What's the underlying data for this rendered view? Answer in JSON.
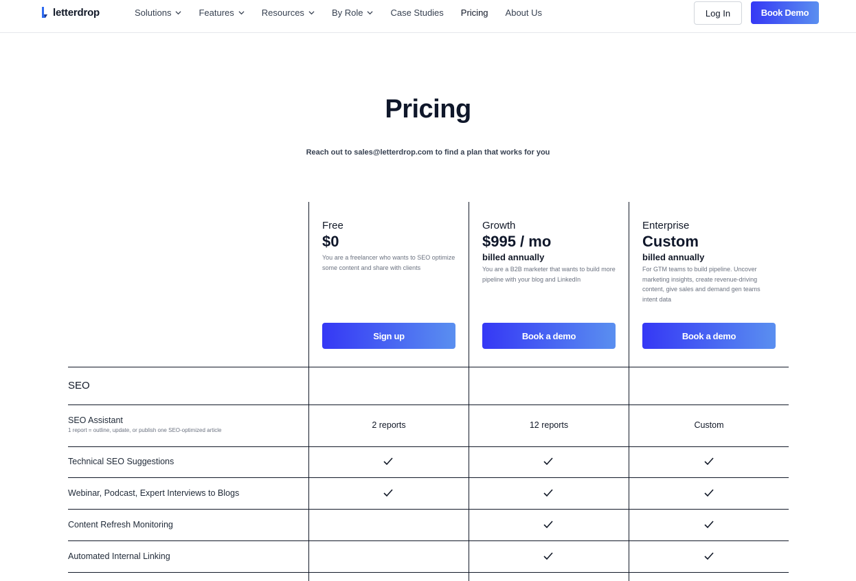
{
  "nav": {
    "logo_text": "letterdrop",
    "items": [
      {
        "label": "Solutions",
        "has_dropdown": true
      },
      {
        "label": "Features",
        "has_dropdown": true
      },
      {
        "label": "Resources",
        "has_dropdown": true
      },
      {
        "label": "By Role",
        "has_dropdown": true
      },
      {
        "label": "Case Studies",
        "has_dropdown": false
      },
      {
        "label": "Pricing",
        "has_dropdown": false
      },
      {
        "label": "About Us",
        "has_dropdown": false
      }
    ],
    "login_label": "Log In",
    "demo_label": "Book Demo"
  },
  "hero": {
    "title": "Pricing",
    "subtitle": "Reach out to sales@letterdrop.com to find a plan that works for you"
  },
  "plans": [
    {
      "name": "Free",
      "price": "$0",
      "billing": "",
      "description": "You are a freelancer who wants to SEO optimize some content and share with clients",
      "button": "Sign up"
    },
    {
      "name": "Growth",
      "price": "$995 / mo",
      "billing": "billed annually",
      "description": "You are a B2B marketer that wants to build more pipeline with your blog and LinkedIn",
      "button": "Book a demo"
    },
    {
      "name": "Enterprise",
      "price": "Custom",
      "billing": "billed annually",
      "description": "For GTM teams to build pipeline. Uncover marketing insights, create revenue-driving content, give sales and demand gen teams intent data",
      "button": "Book a demo"
    }
  ],
  "section": {
    "label": "SEO"
  },
  "features": [
    {
      "name": "SEO Assistant",
      "note": "1 report = outline, update, or publish one SEO-optimized article",
      "values": [
        "2 reports",
        "12 reports",
        "Custom"
      ]
    },
    {
      "name": "Technical SEO Suggestions",
      "note": "",
      "values": [
        "check",
        "check",
        "check"
      ]
    },
    {
      "name": "Webinar, Podcast, Expert Interviews to Blogs",
      "note": "",
      "values": [
        "check",
        "check",
        "check"
      ]
    },
    {
      "name": "Content Refresh Monitoring",
      "note": "",
      "values": [
        "",
        "check",
        "check"
      ]
    },
    {
      "name": "Automated Internal Linking",
      "note": "",
      "values": [
        "",
        "check",
        "check"
      ]
    }
  ],
  "colors": {
    "accent_start": "#3538f5",
    "accent_end": "#5a8ff0"
  }
}
